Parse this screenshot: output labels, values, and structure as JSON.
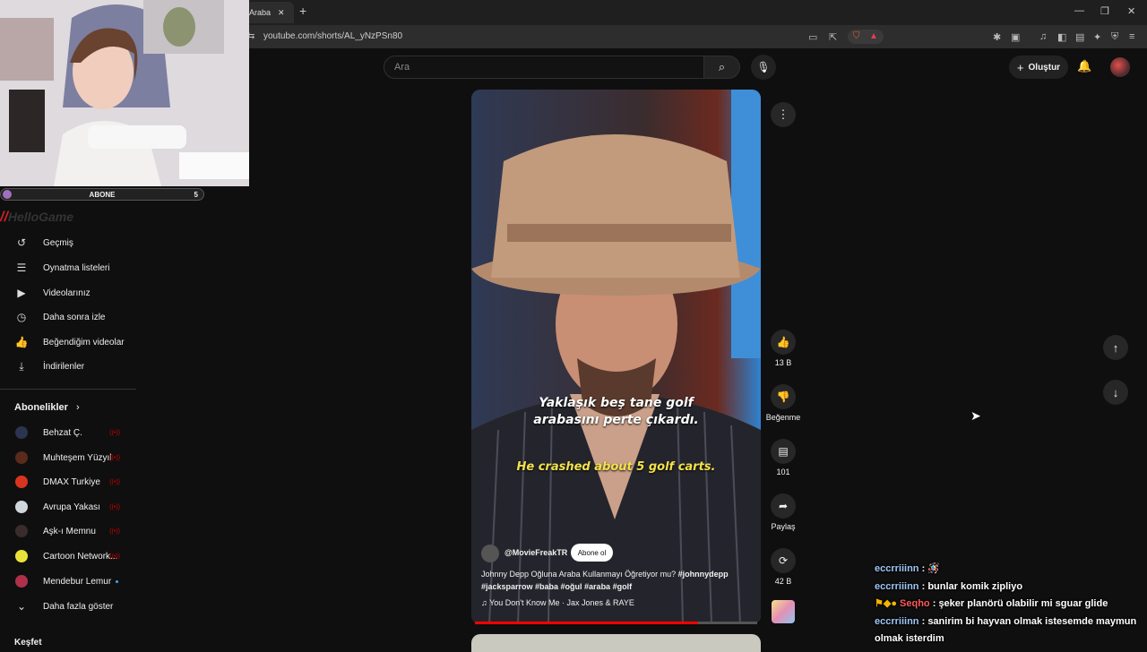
{
  "browser": {
    "tab_title": "Araba",
    "url": "youtube.com/shorts/AL_yNzPSn80"
  },
  "header": {
    "search_placeholder": "Ara",
    "create_label": "Oluştur"
  },
  "overlay": {
    "subscribe_bar_label": "ABONE",
    "subscribe_bar_count": "5",
    "watermark": "HelloGame"
  },
  "sidebar": {
    "items": [
      {
        "label": "Geçmiş",
        "icon": "history-icon"
      },
      {
        "label": "Oynatma listeleri",
        "icon": "playlist-icon"
      },
      {
        "label": "Videolarınız",
        "icon": "your-videos-icon"
      },
      {
        "label": "Daha sonra izle",
        "icon": "watch-later-icon"
      },
      {
        "label": "Beğendiğim videolar",
        "icon": "liked-videos-icon"
      },
      {
        "label": "İndirilenler",
        "icon": "downloads-icon"
      }
    ],
    "subscriptions_title": "Abonelikler",
    "subscriptions": [
      {
        "label": "Behzat Ç.",
        "color": "#2b3550"
      },
      {
        "label": "Muhteşem Yüzyıl",
        "color": "#5a2a1a"
      },
      {
        "label": "DMAX Turkiye",
        "color": "#d8341f"
      },
      {
        "label": "Avrupa Yakası",
        "color": "#cfd6dc"
      },
      {
        "label": "Aşk-ı Memnu",
        "color": "#3a2c2c"
      },
      {
        "label": "Cartoon Network...",
        "color": "#e8e23a"
      },
      {
        "label": "Mendebur Lemur",
        "color": "#b0304a"
      }
    ],
    "show_more_label": "Daha fazla göster",
    "explore_label": "Keşfet"
  },
  "video": {
    "subtitle_tr_line1": "Yaklaşık beş tane golf",
    "subtitle_tr_line2": "arabasını perte çıkardı.",
    "subtitle_en": "He crashed about 5 golf carts.",
    "channel": "@MovieFreakTR",
    "subscribe_label": "Abone ol",
    "title_text": "Johnny Depp Oğluna Araba Kullanmayı Öğretiyor mu? ",
    "title_tags": "#johnnydepp #jacksparrow #baba #oğul #araba #golf",
    "music": "You Don't Know Me · Jax Jones & RAYE",
    "progress": 0.79
  },
  "actions": {
    "like_count": "13 B",
    "dislike_label": "Beğenme",
    "comment_count": "101",
    "share_label": "Paylaş",
    "remix_count": "42 B"
  },
  "chat": [
    {
      "user": "eccrriiinn",
      "msg": "🪅",
      "user_color": "#9ec6f7"
    },
    {
      "user": "eccrriiinn",
      "msg": "bunlar komik zipliyo",
      "user_color": "#9ec6f7"
    },
    {
      "user": "Seqho",
      "msg": "şeker planörü olabilir mi sguar glide",
      "user_color": "#ff5a5a"
    },
    {
      "user": "eccrriiinn",
      "msg": "sanirim bi hayvan olmak istesemde maymun olmak isterdim",
      "user_color": "#9ec6f7"
    }
  ]
}
